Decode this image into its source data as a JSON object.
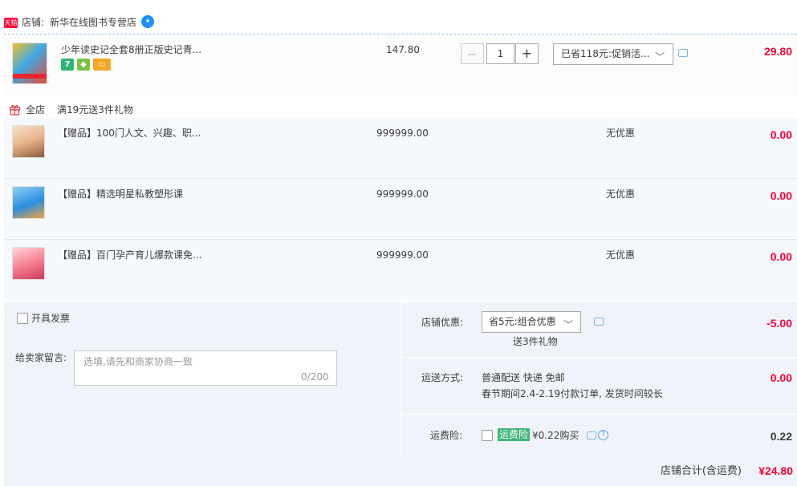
{
  "shop": {
    "badge": "天猫",
    "label": "店铺:",
    "name": "新华在线图书专营店",
    "wangwang_icon": "wangwang-chat-icon"
  },
  "item": {
    "title": "少年读史记全套8册正版史记青...",
    "price": "147.80",
    "quantity": "1",
    "minus_label": "−",
    "plus_label": "+",
    "promo_select": "已省118元:促销活...",
    "amount": "29.80",
    "badges": [
      {
        "text": "7",
        "icon": "seven-day-return-icon",
        "color": "#2bb673"
      },
      {
        "text": "",
        "icon": "guarantee-icon",
        "color": "#7cc242"
      },
      {
        "text": "",
        "icon": "card-payment-icon",
        "color": "#f5a623"
      }
    ]
  },
  "promotion": {
    "scope": "全店",
    "description": "满19元送3件礼物"
  },
  "gifts": [
    {
      "title": "【赠品】100门人文、兴趣、职...",
      "price": "999999.00",
      "discount": "无优惠",
      "amount": "0.00"
    },
    {
      "title": "【赠品】精选明星私教塑形课",
      "price": "999999.00",
      "discount": "无优惠",
      "amount": "0.00"
    },
    {
      "title": "【赠品】百门孕产育儿爆款课免...",
      "price": "999999.00",
      "discount": "无优惠",
      "amount": "0.00"
    }
  ],
  "invoice": {
    "label": "开具发票"
  },
  "message": {
    "label": "给卖家留言:",
    "placeholder": "选填,请先和商家协商一致",
    "count": "0/200"
  },
  "shop_discount": {
    "label": "店铺优惠:",
    "selected": "省5元:组合优惠",
    "note": "送3件礼物",
    "amount": "-5.00"
  },
  "shipping": {
    "label": "运送方式:",
    "method": "普通配送 快递 免邮",
    "note": "春节期间2.4-2.19付款订单, 发货时间较长",
    "amount": "0.00"
  },
  "insurance": {
    "label": "运费险:",
    "tag": "运费险",
    "text": "¥0.22购买",
    "amount": "0.22"
  },
  "total": {
    "label": "店铺合计(含运费)",
    "amount": "¥24.80"
  },
  "colors": {
    "accent_red": "#ff0036",
    "link_blue": "#1d8fff",
    "tag_green": "#3db77a"
  }
}
